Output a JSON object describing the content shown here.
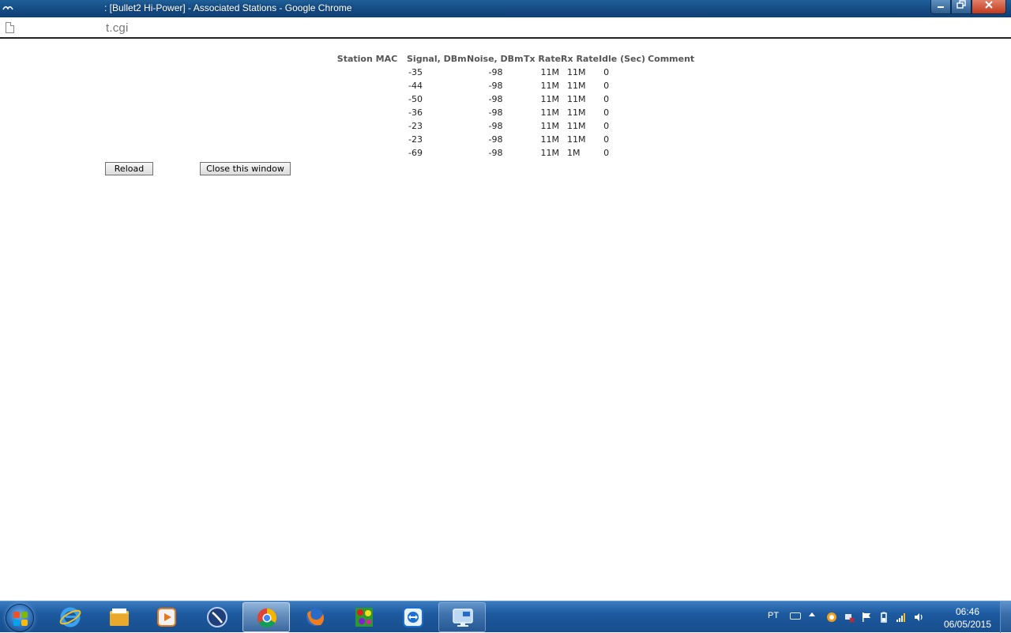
{
  "window": {
    "title": "[Bullet2 Hi-Power] - Associated Stations - Google Chrome",
    "title_prefix": ": "
  },
  "address": {
    "url_tail": "t.cgi"
  },
  "table": {
    "headers": [
      "Station MAC",
      "Signal, DBm",
      "Noise, DBm",
      "Tx Rate",
      "Rx Rate",
      "Idle (Sec)",
      "Comment"
    ],
    "rows": [
      {
        "mac": "",
        "signal": "-35",
        "noise": "-98",
        "tx": "11M",
        "rx": "11M",
        "idle": "0",
        "comment": ""
      },
      {
        "mac": "",
        "signal": "-44",
        "noise": "-98",
        "tx": "11M",
        "rx": "11M",
        "idle": "0",
        "comment": ""
      },
      {
        "mac": "",
        "signal": "-50",
        "noise": "-98",
        "tx": "11M",
        "rx": "11M",
        "idle": "0",
        "comment": ""
      },
      {
        "mac": "",
        "signal": "-36",
        "noise": "-98",
        "tx": "11M",
        "rx": "11M",
        "idle": "0",
        "comment": ""
      },
      {
        "mac": "",
        "signal": "-23",
        "noise": "-98",
        "tx": "11M",
        "rx": "11M",
        "idle": "0",
        "comment": ""
      },
      {
        "mac": "",
        "signal": "-23",
        "noise": "-98",
        "tx": "11M",
        "rx": "11M",
        "idle": "0",
        "comment": ""
      },
      {
        "mac": "",
        "signal": "-69",
        "noise": "-98",
        "tx": "11M",
        "rx": "1M",
        "idle": "0",
        "comment": ""
      }
    ]
  },
  "buttons": {
    "reload": "Reload",
    "close_window": "Close this window"
  },
  "taskbar": {
    "apps": [
      {
        "name": "internet-explorer-icon",
        "state": "pinned"
      },
      {
        "name": "file-explorer-icon",
        "state": "pinned"
      },
      {
        "name": "media-player-icon",
        "state": "pinned"
      },
      {
        "name": "winbox-icon",
        "state": "pinned"
      },
      {
        "name": "chrome-icon",
        "state": "active"
      },
      {
        "name": "firefox-icon",
        "state": "pinned"
      },
      {
        "name": "colorful-app-icon",
        "state": "pinned"
      },
      {
        "name": "teamviewer-icon",
        "state": "pinned"
      },
      {
        "name": "remote-desktop-icon",
        "state": "open"
      }
    ],
    "tray": {
      "language": "PT",
      "time": "06:46",
      "date": "06/05/2015"
    }
  },
  "colors": {
    "titlebar": "#174e86",
    "taskbar": "#1d5a9f",
    "header_text": "#555555"
  }
}
